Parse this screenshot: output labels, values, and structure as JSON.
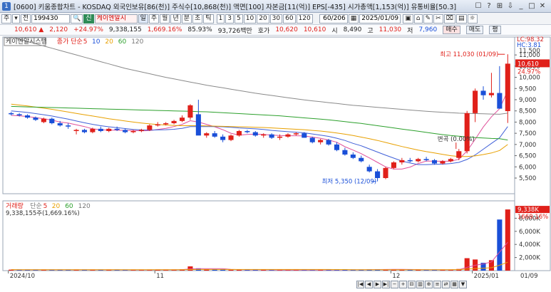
{
  "window": {
    "title": "[0600] 키움종합차트 - KOSDAQ 외국인보유[86(천)] 주식수[10,868(천)] 액면[100] 자본금[11(억)] EPS[-435] 시가총액[1,153(억)] 유통비율[50.3]",
    "controls": [
      "☐",
      "?",
      "⊞",
      "⇩",
      "_",
      "□",
      "✕"
    ]
  },
  "toolbar": {
    "market_btns": [
      "주",
      "▾",
      "전"
    ],
    "code": "199430",
    "company": "케이엔알시",
    "sin": "신",
    "period_btns": [
      "일",
      "주",
      "월",
      "년",
      "분",
      "초",
      "틱"
    ],
    "interval_btns": [
      "1",
      "3",
      "5",
      "10",
      "20",
      "30",
      "60",
      "120"
    ],
    "count": "60/206",
    "date": "2025/01/09",
    "extra_btns": [
      "▣",
      "⌂",
      "✎",
      "✂",
      "⌧",
      "▤",
      "☼"
    ]
  },
  "quote": {
    "price": "10,610",
    "arrow": "▲",
    "change": "2,120",
    "change_pct": "+24.97%",
    "volume": "9,338,155",
    "volume_pct": "1,669.16%",
    "volume_ratio": "85.93%",
    "amount": "93,726백만",
    "ho_label": "호가",
    "ho": "10,620",
    "cur": "10,610",
    "si_label": "시",
    "si": "8,490",
    "go_label": "고",
    "go": "11,030",
    "jeo_label": "저",
    "jeo": "7,960",
    "buy": "매수",
    "sell": "매도",
    "pyeong": "평"
  },
  "chart_data": [
    {
      "type": "candlestick",
      "legend": [
        "케이엔알시스템",
        "종가 단순",
        "5",
        "10",
        "20",
        "60",
        "120"
      ],
      "legend_colors": [
        "#333333",
        "#e0201a",
        "#e0201a",
        "#1a4fd8",
        "#e8a000",
        "#2ca02c",
        "#777777"
      ],
      "ylim": [
        4800,
        11800
      ],
      "yticks": [
        5500,
        6000,
        6500,
        7000,
        7500,
        8000,
        8500,
        9000,
        9500,
        10000,
        10500,
        11000
      ],
      "ytick_labels": [
        "5,500",
        "6,000",
        "6,500",
        "7,000",
        "7,500",
        "8,000",
        "8,500",
        "9,000",
        "9,500",
        "10,000",
        "10,500",
        "11,000"
      ],
      "right_labels": {
        "lc": "LC:98.32",
        "hc": "HC:3.81",
        "top_cut": "11,500",
        "price": "10,610",
        "pct": "24.97%"
      },
      "annotations": {
        "high": "최고 11,030 (01/09)",
        "low": "최저 5,350 (12/09)",
        "pivot": "변곡 (0.00%)"
      },
      "x_labels": [
        "2024/10",
        "11",
        "12",
        "2025/01",
        "01/09"
      ],
      "candles": [
        [
          8400,
          8450,
          8300,
          8350
        ],
        [
          8350,
          8400,
          8250,
          8300
        ],
        [
          8300,
          8350,
          8150,
          8200
        ],
        [
          8200,
          8250,
          8050,
          8100
        ],
        [
          8000,
          8200,
          7950,
          8150
        ],
        [
          8150,
          8200,
          7900,
          7950
        ],
        [
          7950,
          8050,
          7800,
          7850
        ],
        [
          7850,
          7950,
          7700,
          7800
        ],
        [
          7600,
          7700,
          7450,
          7650
        ],
        [
          7650,
          7700,
          7500,
          7550
        ],
        [
          7550,
          7750,
          7500,
          7700
        ],
        [
          7700,
          7800,
          7550,
          7600
        ],
        [
          7600,
          7750,
          7550,
          7700
        ],
        [
          7700,
          7800,
          7600,
          7650
        ],
        [
          7650,
          7700,
          7500,
          7550
        ],
        [
          7550,
          7650,
          7500,
          7600
        ],
        [
          7600,
          7700,
          7550,
          7650
        ],
        [
          7650,
          7900,
          7600,
          7850
        ],
        [
          7850,
          8000,
          7800,
          7900
        ],
        [
          7900,
          8000,
          7850,
          7950
        ],
        [
          7950,
          8100,
          7900,
          8050
        ],
        [
          8050,
          8300,
          8000,
          8200
        ],
        [
          8200,
          8800,
          8100,
          8750
        ],
        [
          8350,
          9000,
          7800,
          7400
        ],
        [
          7400,
          7550,
          7300,
          7500
        ],
        [
          7500,
          7600,
          7300,
          7350
        ],
        [
          7350,
          7450,
          7100,
          7200
        ],
        [
          7200,
          7450,
          7150,
          7400
        ],
        [
          7400,
          7650,
          7350,
          7600
        ],
        [
          7600,
          7650,
          7500,
          7550
        ],
        [
          7550,
          7600,
          7350,
          7400
        ],
        [
          7400,
          7500,
          7300,
          7450
        ],
        [
          7450,
          7500,
          7250,
          7300
        ],
        [
          7300,
          7450,
          7200,
          7350
        ],
        [
          7350,
          7500,
          7300,
          7450
        ],
        [
          7450,
          7550,
          7400,
          7500
        ],
        [
          7500,
          7550,
          7300,
          7300
        ],
        [
          7300,
          7350,
          7050,
          7100
        ],
        [
          7100,
          7250,
          7000,
          7200
        ],
        [
          7200,
          7250,
          6950,
          7000
        ],
        [
          7000,
          7100,
          6700,
          6750
        ],
        [
          6750,
          6850,
          6500,
          6550
        ],
        [
          6550,
          6650,
          6350,
          6400
        ],
        [
          6400,
          6500,
          6200,
          6250
        ],
        [
          6000,
          6100,
          5750,
          5800
        ],
        [
          5800,
          5900,
          5350,
          5500
        ],
        [
          5500,
          6000,
          5450,
          5950
        ],
        [
          5950,
          6250,
          5900,
          6200
        ],
        [
          6200,
          6400,
          6100,
          6300
        ],
        [
          6300,
          6400,
          6200,
          6250
        ],
        [
          6250,
          6400,
          6200,
          6350
        ],
        [
          6350,
          6450,
          6250,
          6300
        ],
        [
          6300,
          6350,
          6100,
          6150
        ],
        [
          6150,
          6300,
          6100,
          6250
        ],
        [
          6250,
          6400,
          6200,
          6350
        ],
        [
          6400,
          6800,
          6300,
          6700
        ],
        [
          6700,
          8500,
          6600,
          8400
        ],
        [
          8400,
          9500,
          8000,
          9400
        ],
        [
          9400,
          9600,
          9000,
          9200
        ],
        [
          9200,
          10200,
          9100,
          9300
        ],
        [
          9300,
          10500,
          8800,
          8600
        ],
        [
          8490,
          11030,
          7960,
          10610
        ]
      ],
      "ma": {
        "5": [
          8300,
          8280,
          8250,
          8200,
          8150,
          8090,
          8000,
          7960,
          7880,
          7800,
          7700,
          7660,
          7640,
          7640,
          7630,
          7630,
          7610,
          7620,
          7670,
          7720,
          7800,
          7900,
          8060,
          8000,
          7900,
          7790,
          7660,
          7500,
          7420,
          7450,
          7460,
          7450,
          7420,
          7400,
          7390,
          7390,
          7380,
          7330,
          7280,
          7200,
          7100,
          6900,
          6750,
          6590,
          6400,
          6200,
          6000,
          5900,
          5900,
          5990,
          6150,
          6260,
          6250,
          6250,
          6250,
          6340,
          6710,
          7230,
          7780,
          8240,
          8600,
          9400
        ],
        "10": [
          8500,
          8470,
          8430,
          8380,
          8330,
          8270,
          8200,
          8130,
          8050,
          7970,
          7900,
          7840,
          7790,
          7750,
          7710,
          7670,
          7650,
          7640,
          7650,
          7660,
          7680,
          7720,
          7800,
          7800,
          7800,
          7800,
          7790,
          7770,
          7740,
          7720,
          7700,
          7670,
          7630,
          7600,
          7570,
          7550,
          7520,
          7470,
          7420,
          7360,
          7280,
          7180,
          7050,
          6940,
          6800,
          6660,
          6520,
          6390,
          6260,
          6170,
          6100,
          6100,
          6110,
          6120,
          6150,
          6200,
          6330,
          6530,
          6790,
          7050,
          7300,
          7800
        ],
        "20": [
          8800,
          8760,
          8720,
          8670,
          8620,
          8570,
          8510,
          8450,
          8390,
          8330,
          8270,
          8210,
          8150,
          8100,
          8050,
          8000,
          7960,
          7920,
          7890,
          7870,
          7850,
          7840,
          7840,
          7840,
          7830,
          7820,
          7810,
          7800,
          7790,
          7780,
          7770,
          7760,
          7740,
          7720,
          7700,
          7680,
          7660,
          7630,
          7600,
          7560,
          7510,
          7460,
          7400,
          7330,
          7260,
          7180,
          7090,
          7000,
          6910,
          6830,
          6750,
          6680,
          6620,
          6560,
          6500,
          6460,
          6460,
          6490,
          6550,
          6620,
          6730,
          7000
        ],
        "60": [
          8700,
          8690,
          8680,
          8670,
          8660,
          8650,
          8640,
          8630,
          8620,
          8610,
          8600,
          8590,
          8580,
          8570,
          8560,
          8550,
          8540,
          8530,
          8520,
          8510,
          8500,
          8490,
          8480,
          8470,
          8460,
          8440,
          8420,
          8400,
          8380,
          8360,
          8340,
          8320,
          8300,
          8280,
          8250,
          8220,
          8190,
          8160,
          8130,
          8100,
          8060,
          8020,
          7980,
          7940,
          7890,
          7840,
          7790,
          7740,
          7690,
          7640,
          7590,
          7540,
          7490,
          7440,
          7400,
          7370,
          7340,
          7310,
          7290,
          7270,
          7260,
          7200
        ],
        "120": [
          11800,
          11700,
          11600,
          11500,
          11400,
          11300,
          11200,
          11100,
          11000,
          10900,
          10800,
          10700,
          10600,
          10500,
          10400,
          10320,
          10240,
          10160,
          10080,
          10000,
          9930,
          9860,
          9790,
          9720,
          9650,
          9590,
          9530,
          9470,
          9410,
          9350,
          9290,
          9240,
          9190,
          9140,
          9090,
          9040,
          8990,
          8950,
          8910,
          8870,
          8830,
          8790,
          8750,
          8720,
          8690,
          8660,
          8630,
          8600,
          8570,
          8540,
          8510,
          8480,
          8460,
          8440,
          8420,
          8400,
          8390,
          8380,
          8370,
          8360,
          8350,
          8400
        ]
      }
    },
    {
      "type": "bar",
      "legend": [
        "거래량",
        "단순",
        "5",
        "20",
        "60",
        "120"
      ],
      "legend_colors": [
        "#e0201a",
        "#777777",
        "#e0201a",
        "#e8a000",
        "#2ca02c",
        "#777777"
      ],
      "subtitle": "9,338,155주(1,669.16%)",
      "ylim": [
        0,
        10000000
      ],
      "yticks": [
        2000000,
        4000000,
        6000000,
        8000000
      ],
      "ytick_labels": [
        "2,000K",
        "4,000K",
        "6,000K",
        "8,000K"
      ],
      "right_labels": {
        "vol": "9,338K",
        "pct": "1669.16%"
      },
      "values": [
        150000,
        140000,
        130000,
        120000,
        160000,
        150000,
        140000,
        130000,
        150000,
        130000,
        140000,
        120000,
        130000,
        120000,
        110000,
        110000,
        120000,
        140000,
        150000,
        130000,
        150000,
        200000,
        650000,
        350000,
        180000,
        160000,
        150000,
        130000,
        150000,
        120000,
        110000,
        120000,
        110000,
        100000,
        110000,
        100000,
        120000,
        130000,
        120000,
        110000,
        140000,
        150000,
        130000,
        140000,
        180000,
        220000,
        200000,
        170000,
        160000,
        130000,
        140000,
        120000,
        130000,
        110000,
        130000,
        250000,
        1900000,
        1700000,
        1200000,
        1600000,
        7800000,
        9338155
      ],
      "up": [
        1,
        0,
        0,
        0,
        1,
        0,
        0,
        0,
        1,
        0,
        1,
        0,
        1,
        0,
        0,
        1,
        1,
        1,
        1,
        1,
        1,
        1,
        1,
        0,
        1,
        0,
        0,
        1,
        1,
        0,
        0,
        1,
        0,
        1,
        1,
        1,
        0,
        0,
        1,
        0,
        0,
        0,
        0,
        0,
        0,
        0,
        1,
        1,
        1,
        0,
        1,
        0,
        0,
        1,
        1,
        1,
        1,
        1,
        0,
        1,
        0,
        1
      ]
    }
  ],
  "nav": [
    "|◀",
    "◀",
    "▶",
    "▶|",
    "−",
    "+",
    "⊟",
    "▥",
    "⊕",
    "≡",
    "⇄",
    "▦",
    "▼"
  ]
}
